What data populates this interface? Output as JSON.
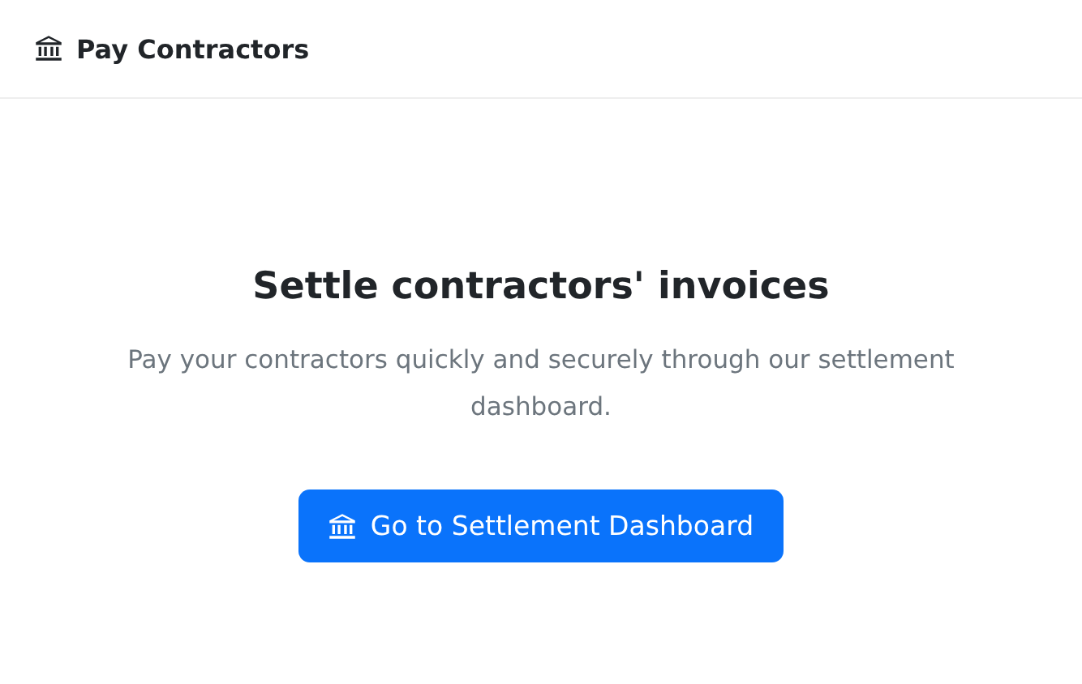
{
  "navbar": {
    "brand": "Pay Contractors"
  },
  "hero": {
    "title": "Settle contractors' invoices",
    "text": "Pay your contractors quickly and securely through our settlement dashboard.",
    "button": "Go to Settlement Dashboard"
  }
}
